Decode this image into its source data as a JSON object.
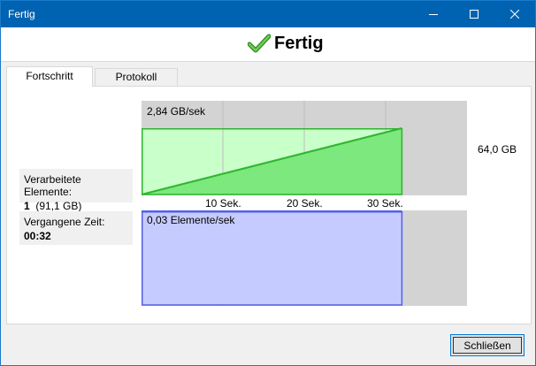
{
  "window": {
    "title": "Fertig"
  },
  "header": {
    "title": "Fertig",
    "icon": "checkmark-icon",
    "icon_color": "#3c9a2b"
  },
  "tabs": [
    {
      "label": "Fortschritt",
      "active": true
    },
    {
      "label": "Protokoll",
      "active": false
    }
  ],
  "progress": {
    "processed_label": "Verarbeitete Elemente:",
    "processed_count": "1",
    "processed_size": "(91,1 GB)",
    "elapsed_label": "Vergangene Zeit:",
    "elapsed_value": "00:32"
  },
  "throughput_graph": {
    "rate_label": "2,84 GB/sek",
    "total_label": "64,0 GB",
    "x_ticks": [
      "10 Sek.",
      "20 Sek.",
      "30 Sek."
    ],
    "fill_color": "#c9ffc9",
    "line_color": "#2fb52f"
  },
  "items_graph": {
    "rate_label": "0,03 Elemente/sek",
    "fill_color": "#c6cbff",
    "line_color": "#5460e6"
  },
  "chart_data": [
    {
      "type": "area",
      "title": "2,84 GB/sek",
      "xlabel": "",
      "ylabel": "",
      "x": [
        0,
        32
      ],
      "series": [
        {
          "values": [
            0,
            64.0
          ]
        }
      ],
      "xticks": [
        "10 Sek.",
        "20 Sek.",
        "30 Sek."
      ],
      "xlim": [
        0,
        40
      ],
      "ylim": [
        0,
        64.0
      ],
      "grid": true
    },
    {
      "type": "area",
      "title": "0,03 Elemente/sek",
      "xlabel": "",
      "ylabel": "",
      "x": [
        0,
        32
      ],
      "series": [
        {
          "values": [
            1,
            1
          ]
        }
      ],
      "xlim": [
        0,
        40
      ],
      "ylim": [
        0,
        1
      ],
      "grid": true
    }
  ],
  "footer": {
    "close_label": "Schließen"
  }
}
